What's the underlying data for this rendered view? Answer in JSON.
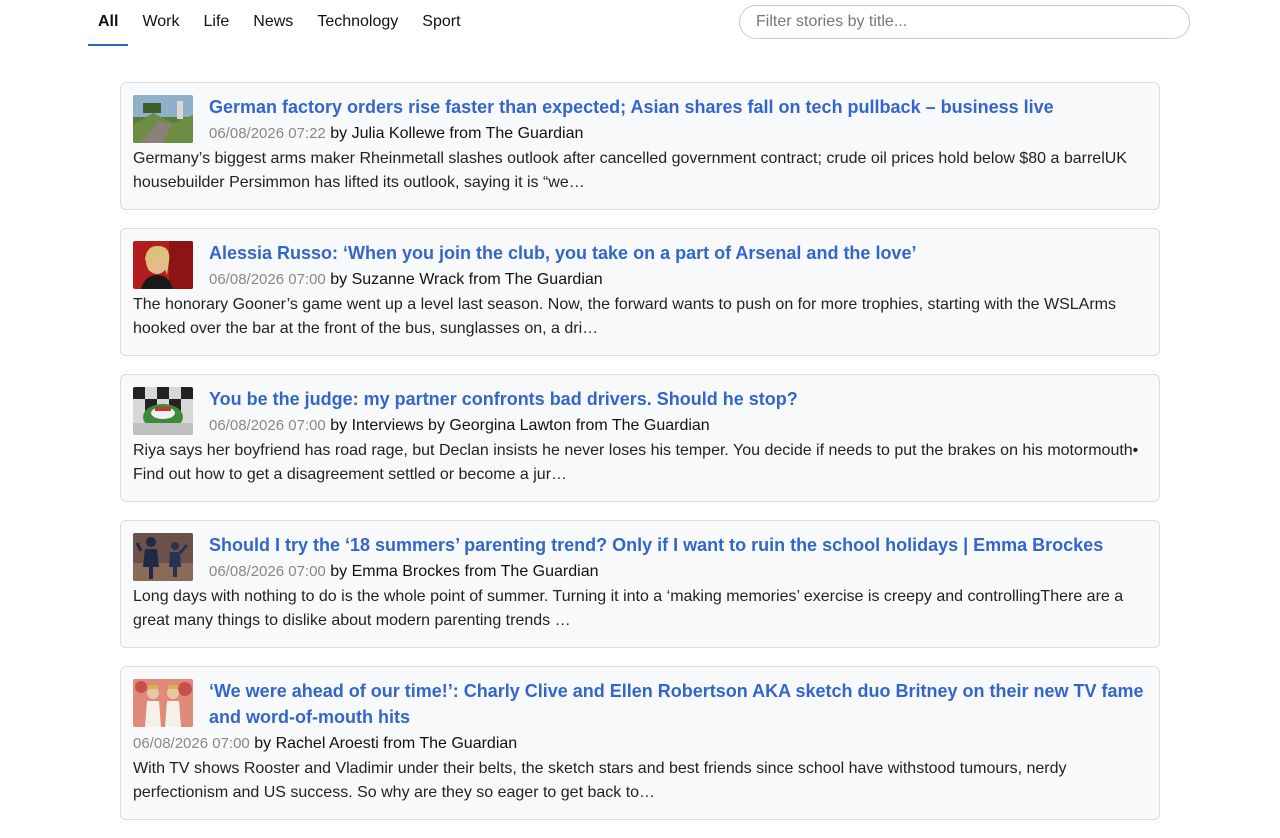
{
  "nav": {
    "tabs": [
      {
        "label": "All",
        "active": true
      },
      {
        "label": "Work"
      },
      {
        "label": "Life"
      },
      {
        "label": "News"
      },
      {
        "label": "Technology"
      },
      {
        "label": "Sport"
      }
    ]
  },
  "filter": {
    "placeholder": "Filter stories by title..."
  },
  "stories": [
    {
      "title": "German factory orders rise faster than expected; Asian shares fall on tech pullback – business live",
      "date": "06/08/2026 07:22",
      "byline": "by Julia Kollewe from The Guardian",
      "summary": "Germany’s biggest arms maker Rheinmetall slashes outlook after cancelled government contract; crude oil prices hold below $80 a barrelUK housebuilder Persimmon has lifted its outlook, saying it is “we…",
      "thumb": "landscape-icon"
    },
    {
      "title": "Alessia Russo: ‘When you join the club, you take on a part of Arsenal and the love’",
      "date": "06/08/2026 07:00",
      "byline": "by Suzanne Wrack from The Guardian",
      "summary": "The honorary Gooner’s game went up a level last season. Now, the forward wants to push on for more trophies, starting with the WSLArms hooked over the bar at the front of the bus, sunglasses on, a dri…",
      "thumb": "portrait-icon"
    },
    {
      "title": "You be the judge: my partner confronts bad drivers. Should he stop?",
      "date": "06/08/2026 07:00",
      "byline": "by Interviews by Georgina Lawton from The Guardian",
      "summary": "Riya says her boyfriend has road rage, but Declan insists he never loses his temper. You decide if needs to put the brakes on his motormouth• Find out how to get a disagreement settled or become a jur…",
      "thumb": "car-icon"
    },
    {
      "title": "Should I try the ‘18 summers’ parenting trend? Only if I want to ruin the school holidays | Emma Brockes",
      "date": "06/08/2026 07:00",
      "byline": "by Emma Brockes from The Guardian",
      "summary": "Long days with nothing to do is the whole point of summer. Turning it into a ‘making memories’ exercise is creepy and controllingThere are a great many things to dislike about modern parenting trends …",
      "thumb": "silhouettes-icon"
    },
    {
      "title": "‘We were ahead of our time!’: Charly Clive and Ellen Robertson AKA sketch duo Britney on their new TV fame and word-of-mouth hits",
      "date": "06/08/2026 07:00",
      "byline": "by Rachel Aroesti from The Guardian",
      "summary": "With TV shows Rooster and Vladimir under their belts, the sketch stars and best friends since school have withstood tumours, nerdy perfectionism and US success. So why are they so eager to get back to…",
      "thumb": "duo-icon"
    }
  ]
}
